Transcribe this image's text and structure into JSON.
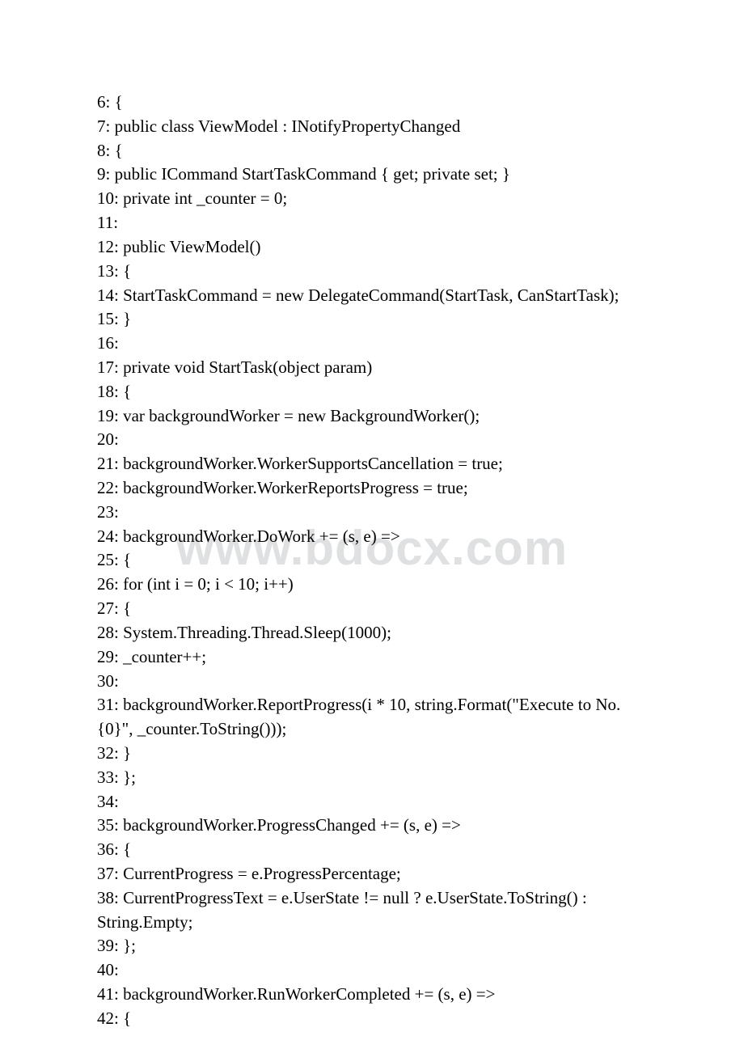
{
  "watermark": "www.bdocx.com",
  "lines": [
    "6: {",
    "7: public class ViewModel : INotifyPropertyChanged",
    "8: {",
    "9: public ICommand StartTaskCommand { get; private set; }",
    "10: private int _counter = 0;",
    "11:",
    "12: public ViewModel()",
    "13: {",
    "14: StartTaskCommand = new DelegateCommand(StartTask, CanStartTask);",
    "15: }",
    "16:",
    "17: private void StartTask(object param)",
    "18: {",
    "19: var backgroundWorker = new BackgroundWorker();",
    "20:",
    "21: backgroundWorker.WorkerSupportsCancellation = true;",
    "22: backgroundWorker.WorkerReportsProgress = true;",
    "23:",
    "24: backgroundWorker.DoWork += (s, e) =>",
    "25: {",
    "26: for (int i = 0; i < 10; i++)",
    "27: {",
    "28: System.Threading.Thread.Sleep(1000);",
    "29: _counter++;",
    "30:",
    "31: backgroundWorker.ReportProgress(i * 10, string.Format(\"Execute to No.{0}\", _counter.ToString()));",
    "32: }",
    "33: };",
    "34:",
    "35: backgroundWorker.ProgressChanged += (s, e) =>",
    "36: {",
    "37: CurrentProgress = e.ProgressPercentage;",
    "38: CurrentProgressText = e.UserState != null ? e.UserState.ToString() : String.Empty;",
    "39: };",
    "40:",
    "41: backgroundWorker.RunWorkerCompleted += (s, e) =>",
    "42: {"
  ]
}
